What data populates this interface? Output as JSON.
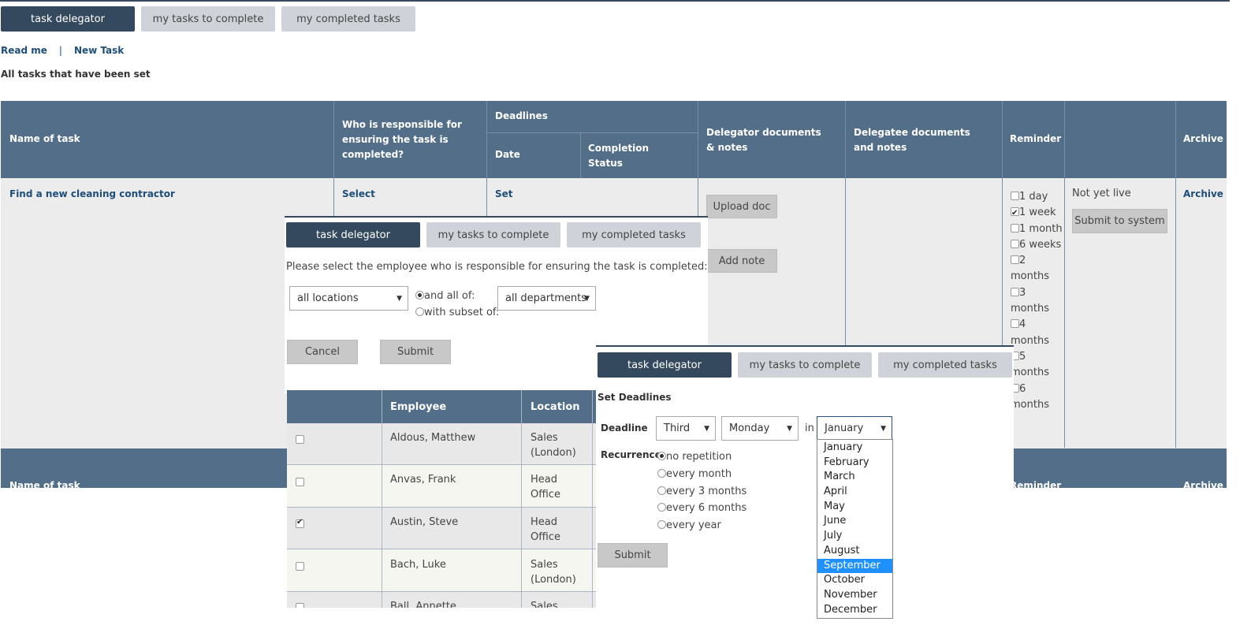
{
  "tabs": [
    {
      "label": "task delegator",
      "active": true
    },
    {
      "label": "my tasks to complete",
      "active": false
    },
    {
      "label": "my completed tasks",
      "active": false
    }
  ],
  "links": {
    "read_me": "Read me",
    "separator": "|",
    "new_task": "New Task"
  },
  "page_label": "All tasks that have been set",
  "table": {
    "headers": {
      "name": "Name of task",
      "responsible": "Who is responsible for ensuring the task is completed?",
      "deadlines": "Deadlines",
      "date": "Date",
      "completion": "Completion Status",
      "delegator_docs": "Delegator documents & notes",
      "delegatee_docs": "Delegatee documents and notes",
      "reminder": "Reminder",
      "archive": "Archive"
    },
    "row": {
      "task_name": "Find a new cleaning contractor",
      "select_link": "Select",
      "set_link": "Set",
      "upload_doc": "Upload doc",
      "add_note": "Add note",
      "status": "Not yet live",
      "submit_to_system": "Submit to system",
      "archive_link": "Archive",
      "reminders": [
        {
          "label": "1 day",
          "checked": false
        },
        {
          "label": "1 week",
          "checked": true
        },
        {
          "label": "1 month",
          "checked": false
        },
        {
          "label": "6 weeks",
          "checked": false
        },
        {
          "label": "2 months",
          "checked": false
        },
        {
          "label": "3 months",
          "checked": false
        },
        {
          "label": "4 months",
          "checked": false
        },
        {
          "label": "5 months",
          "checked": false
        },
        {
          "label": "6 months",
          "checked": false
        }
      ]
    },
    "footer_headers": {
      "name": "Name of task",
      "reminder": "Reminder",
      "archive": "Archive"
    }
  },
  "employee_panel": {
    "tabs": [
      "task delegator",
      "my tasks to complete",
      "my completed tasks"
    ],
    "prompt": "Please select the employee who is responsible for ensuring the task is completed:",
    "location_select": "all locations",
    "radio_all": "and all of:",
    "radio_subset": "with subset of:",
    "department_select": "all departments",
    "cancel": "Cancel",
    "submit": "Submit",
    "columns": {
      "employee": "Employee",
      "location": "Location"
    },
    "rows": [
      {
        "name": "Aldous, Matthew",
        "location": "Sales (London)",
        "checked": false
      },
      {
        "name": "Anvas, Frank",
        "location": "Head Office",
        "checked": false
      },
      {
        "name": "Austin, Steve",
        "location": "Head Office",
        "checked": true
      },
      {
        "name": "Bach, Luke",
        "location": "Sales (London)",
        "checked": false
      },
      {
        "name": "Ball, Annette",
        "location": "Sales",
        "checked": false
      }
    ]
  },
  "deadline_panel": {
    "tabs": [
      "task delegator",
      "my tasks to complete",
      "my completed tasks"
    ],
    "title": "Set Deadlines",
    "deadline_label": "Deadline",
    "ordinal": "Third",
    "weekday": "Monday",
    "in_label": "in",
    "month": "January",
    "recurrence_label": "Recurrence",
    "recurrence_options": [
      {
        "label": "no repetition",
        "checked": true
      },
      {
        "label": "every month",
        "checked": false
      },
      {
        "label": "every 3 months",
        "checked": false
      },
      {
        "label": "every 6 months",
        "checked": false
      },
      {
        "label": "every year",
        "checked": false
      }
    ],
    "submit": "Submit",
    "months": [
      "January",
      "February",
      "March",
      "April",
      "May",
      "June",
      "July",
      "August",
      "September",
      "October",
      "November",
      "December"
    ],
    "highlighted_month": "September"
  }
}
